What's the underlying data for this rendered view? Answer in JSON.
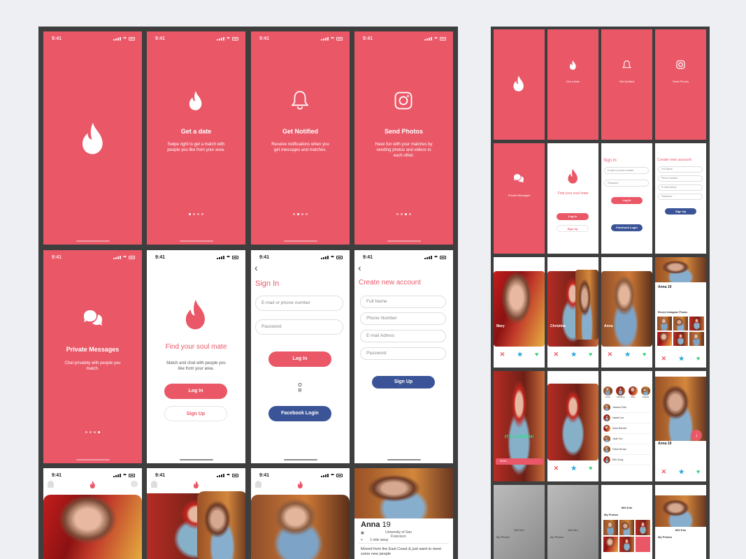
{
  "status_time": "9:41",
  "colors": {
    "brand": "#ea5868",
    "facebook": "#3a5497",
    "board": "#3e3e3e"
  },
  "onboard": {
    "date": {
      "title": "Get a date",
      "desc": "Swipe right to get a match with people you like from your area."
    },
    "notified": {
      "title": "Get Notified",
      "desc": "Receive notifications when you get messages and matches."
    },
    "photos": {
      "title": "Send Photos",
      "desc": "Have fun with your matches by sending photos and videos to each other."
    },
    "messages": {
      "title": "Private Messages",
      "desc": "Chat privately with people you match."
    }
  },
  "welcome": {
    "title": "Find your soul mate",
    "desc": "Match and chat with people you like from your area.",
    "login": "Log In",
    "signup": "Sign Up"
  },
  "signin": {
    "title": "Sign In",
    "email_placeholder": "E-mail or phone number",
    "password_placeholder": "Password",
    "login": "Log In",
    "or": "OR",
    "facebook": "Facebook Login"
  },
  "create": {
    "title": "Create new account",
    "fullname": "Full Name",
    "phone": "Phone Number",
    "email": "E-mail Adress",
    "password": "Password",
    "signup": "Sign Up"
  },
  "profile": {
    "name": "Anna",
    "age": "19",
    "school": "University of San Francisco",
    "distance": "1 mile away",
    "bio": "Moved from the East Coast & just want to meet some new people"
  },
  "mini": {
    "mary": "Mary",
    "christina": "Christina",
    "anna": "Anna",
    "recent_photos": "Recent Instagram Photos",
    "match": "IT'S A MATCH!",
    "send": "SEND",
    "chat_names": [
      "Anna",
      "Christina",
      "Mary",
      "Juliette"
    ],
    "chats": [
      "Jessica Park",
      "Isabel Lee",
      "Anna Bendel",
      "Jade Yoo",
      "Chloe Brown",
      "Ella Gong"
    ],
    "will_kim": "Will Kim",
    "my_photos": "My Photos"
  }
}
